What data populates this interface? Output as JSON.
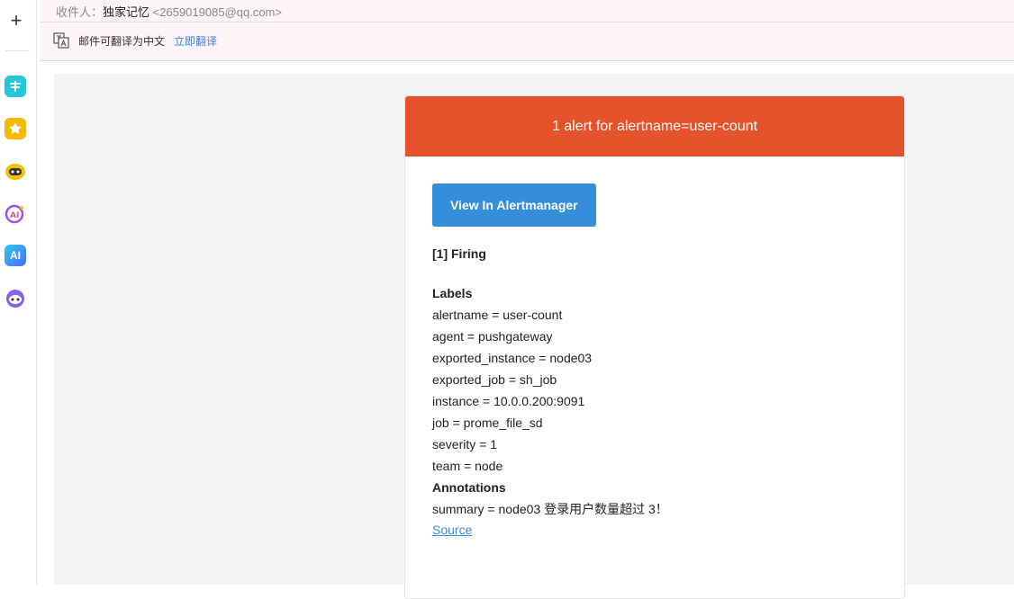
{
  "sidebar": {
    "apps": [
      {
        "icon": "translate-app-icon",
        "color": "#26c6da"
      },
      {
        "icon": "star-app-icon",
        "color": "#f6b800"
      },
      {
        "icon": "robot-app-icon",
        "color": "#f2c200"
      },
      {
        "icon": "ai-ring-app-icon",
        "color": "#a050f0"
      },
      {
        "icon": "ai-app-icon",
        "color": "#3aa0ff",
        "label": "AI"
      },
      {
        "icon": "bot-face-app-icon",
        "color": "#8860ee"
      }
    ]
  },
  "header": {
    "recipient_label": "收件人：",
    "recipient_name": "独家记忆",
    "recipient_email": "<2659019085@qq.com>",
    "translate_text": "邮件可翻译为中文",
    "translate_link": "立即翻译"
  },
  "alert": {
    "header_title": "1 alert for alertname=user-count",
    "button_label": "View In Alertmanager",
    "firing": "[1] Firing",
    "labels_heading": "Labels",
    "labels": [
      "alertname = user-count",
      "agent = pushgateway",
      "exported_instance = node03",
      "exported_job = sh_job",
      "instance = 10.0.0.200:9091",
      "job = prome_file_sd",
      "severity = 1",
      "team = node"
    ],
    "annotations_heading": "Annotations",
    "annotations": [
      "summary = node03 登录用户数量超过 3！"
    ],
    "source_link": "Source",
    "header_color": "#e6522c",
    "button_color": "#348eda"
  }
}
